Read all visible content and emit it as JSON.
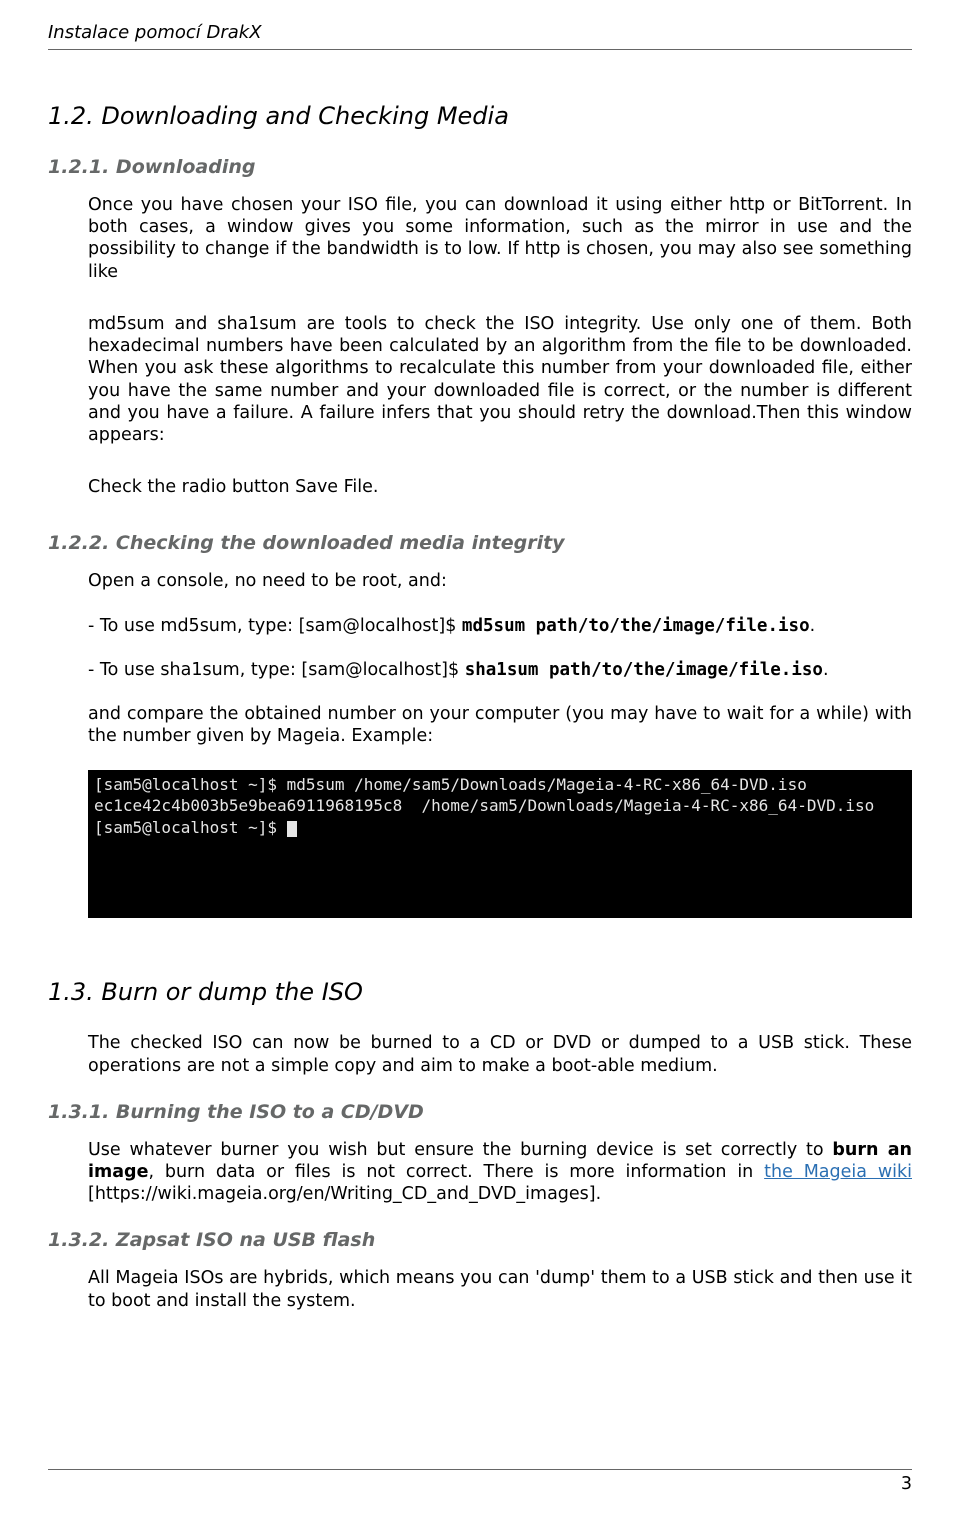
{
  "header": {
    "title": "Instalace pomocí DrakX"
  },
  "sec12": {
    "heading": "1.2. Downloading and Checking Media",
    "sub1": {
      "heading": "1.2.1. Downloading",
      "para1": "Once you have chosen your ISO file, you can download it using either http or BitTorrent. In both cases, a window gives you some information, such as the mirror in use and the possibility to change if the bandwidth is to low. If http is chosen, you may also see something like",
      "para2": "md5sum and sha1sum are tools to check the ISO integrity. Use only one of them. Both hexadecimal numbers have been calculated by an algorithm from the file to be downloaded. When you ask these algorithms to recalculate this number from your downloaded file, either you have the same number and your downloaded file is correct, or the number is different and you have a failure. A failure infers that you should retry the download.Then this window appears:",
      "para3": "Check the radio button Save File."
    },
    "sub2": {
      "heading": "1.2.2. Checking the downloaded media integrity",
      "open": "Open a console, no need to be root, and:",
      "md5_pre": "- To use md5sum, type: [sam@localhost]$ ",
      "md5_cmd": "md5sum path/to/the/image/file.iso",
      "md5_post": ".",
      "sha_pre": "- To use sha1sum, type: [sam@localhost]$ ",
      "sha_cmd": "sha1sum path/to/the/image/file.iso",
      "sha_post": ".",
      "compare": "and compare the obtained number on your computer (you may have to wait for a while) with the number given by Mageia. Example:",
      "terminal": "[sam5@localhost ~]$ md5sum /home/sam5/Downloads/Mageia-4-RC-x86_64-DVD.iso\nec1ce42c4b003b5e9bea6911968195c8  /home/sam5/Downloads/Mageia-4-RC-x86_64-DVD.iso\n[sam5@localhost ~]$ "
    }
  },
  "sec13": {
    "heading": "1.3. Burn or dump the ISO",
    "intro": "The checked ISO can now be burned to a CD or DVD or dumped to a USB stick. These operations are not a simple copy and aim to make a boot-able medium.",
    "sub1": {
      "heading": "1.3.1. Burning the ISO to a CD/DVD",
      "para_pre": "Use whatever burner you wish but ensure the burning device is set correctly to ",
      "bold": "burn an image",
      "para_mid": ", burn data or files is not correct. There is more information in ",
      "link_text": "the Mageia wiki",
      "para_post": " [https://wiki.mageia.org/en/Writing_CD_and_DVD_images]."
    },
    "sub2": {
      "heading": "1.3.2. Zapsat ISO na USB flash",
      "para": "All Mageia ISOs are hybrids, which means you can 'dump' them to a USB stick and then use it to boot and install the system."
    }
  },
  "footer": {
    "page": "3"
  }
}
